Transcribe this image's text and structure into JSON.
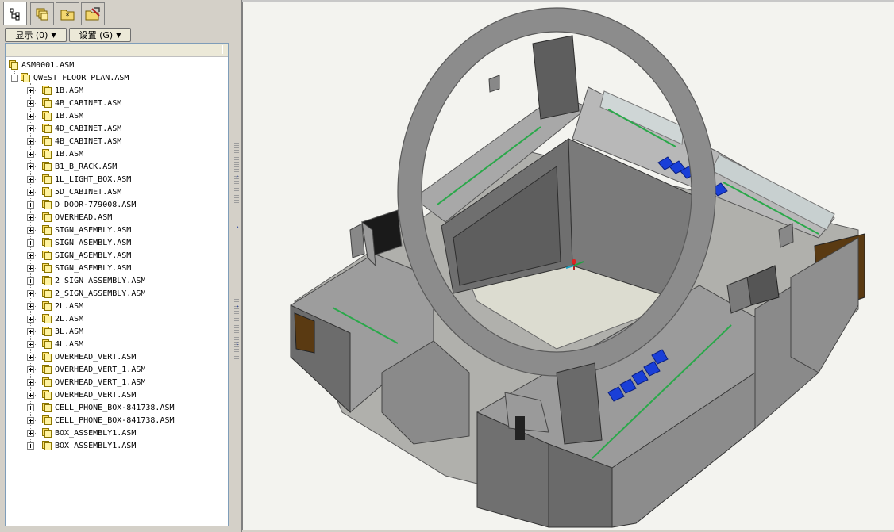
{
  "tabs": [
    {
      "name": "model-tree-icon",
      "active": true
    },
    {
      "name": "folder-browser-icon",
      "active": false
    },
    {
      "name": "favorites-icon",
      "active": false
    },
    {
      "name": "connections-icon",
      "active": false
    }
  ],
  "toolbar": {
    "show_label": "显示 (0)",
    "settings_label": "设置 (G)"
  },
  "tree": {
    "root": "ASM0001.ASM",
    "sub_root": "QWEST_FLOOR_PLAN.ASM",
    "items": [
      "1B.ASM",
      "4B_CABINET.ASM",
      "1B.ASM",
      "4D_CABINET.ASM",
      "4B_CABINET.ASM",
      "1B.ASM",
      "B1_B_RACK.ASM",
      "1L_LIGHT_BOX.ASM",
      "5D_CABINET.ASM",
      "D_DOOR-779008.ASM",
      "OVERHEAD.ASM",
      "SIGN_ASEMBLY.ASM",
      "SIGN_ASEMBLY.ASM",
      "SIGN_ASEMBLY.ASM",
      "SIGN_ASEMBLY.ASM",
      "2_SIGN_ASSEMBLY.ASM",
      "2_SIGN_ASSEMBLY.ASM",
      "2L.ASM",
      "2L.ASM",
      "3L.ASM",
      "4L.ASM",
      "OVERHEAD_VERT.ASM",
      "OVERHEAD_VERT_1.ASM",
      "OVERHEAD_VERT_1.ASM",
      "OVERHEAD_VERT.ASM",
      "CELL_PHONE_BOX-841738.ASM",
      "CELL_PHONE_BOX-841738.ASM",
      "BOX_ASSEMBLY1.ASM",
      "BOX_ASSEMBLY1.ASM"
    ]
  },
  "colors": {
    "model_gray": "#9a9a9a",
    "model_dark": "#6e6e6e",
    "floor": "#dcdcd0",
    "accent_blue": "#1a3fd8",
    "accent_green": "#2aa84a",
    "wood": "#5a3a12"
  }
}
